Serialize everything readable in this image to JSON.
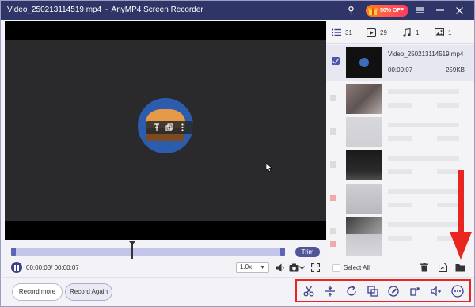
{
  "window": {
    "file_name": "Video_250213114519.mp4",
    "separator": "-",
    "app_name": "AnyMP4 Screen Recorder",
    "promo_label": "50% OFF"
  },
  "timeline": {
    "trim_label": "Trim",
    "time_display": "00:00:03/ 00:00:07",
    "speed_value": "1.0x"
  },
  "bottom": {
    "record_more_label": "Record more",
    "record_again_label": "Record Again"
  },
  "panel": {
    "tabs": [
      {
        "icon": "list-icon",
        "count": "31"
      },
      {
        "icon": "video-icon",
        "count": "29"
      },
      {
        "icon": "music-icon",
        "count": "1"
      },
      {
        "icon": "image-icon",
        "count": "1"
      }
    ],
    "selected_item": {
      "name": "Video_250213114519.mp4",
      "duration": "00:00:07",
      "size": "259KB"
    },
    "select_all_label": "Select All"
  },
  "colors": {
    "titlebar": "#2f3566",
    "accent": "#4a54a8",
    "highlight": "#e8251f"
  }
}
